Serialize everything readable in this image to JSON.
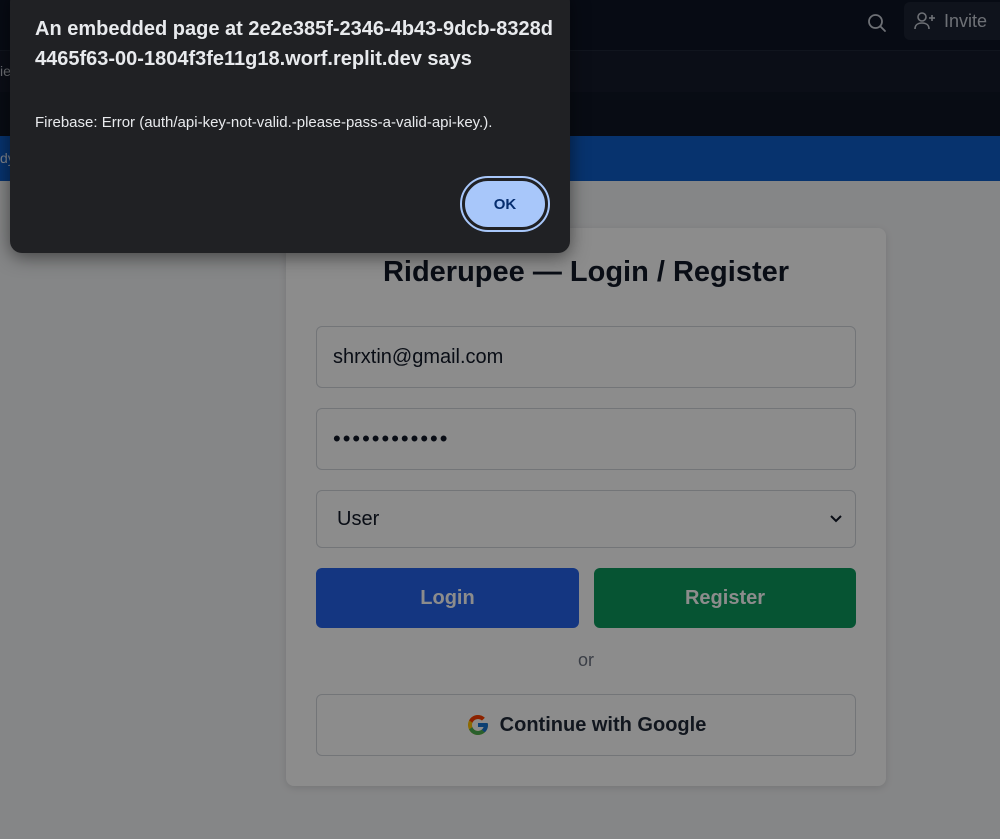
{
  "topbar": {
    "invite_label": "Invite",
    "left_fragment": "ie",
    "blue_fragment": "dy"
  },
  "card": {
    "title": "Riderupee — Login / Register",
    "email_value": "shrxtin@gmail.com",
    "password_value": "••••••••••••",
    "role_selected": "User",
    "login_label": "Login",
    "register_label": "Register",
    "or_label": "or",
    "google_label": "Continue with Google"
  },
  "dialog": {
    "title": "An embedded page at 2e2e385f-2346-4b43-9dcb-8328d4465f63-00-1804f3fe11g18.worf.replit.dev says",
    "message": "Firebase: Error (auth/api-key-not-valid.-please-pass-a-valid-api-key.).",
    "ok_label": "OK"
  },
  "colors": {
    "login_bg": "#2563eb",
    "register_bg": "#0b9a5d",
    "dialog_bg": "#202124",
    "ok_bg": "#a8c7fa",
    "accent_bar": "#0d5ec9"
  },
  "icons": [
    "search-icon",
    "add-user-icon",
    "google-icon",
    "chevron-down-icon"
  ]
}
